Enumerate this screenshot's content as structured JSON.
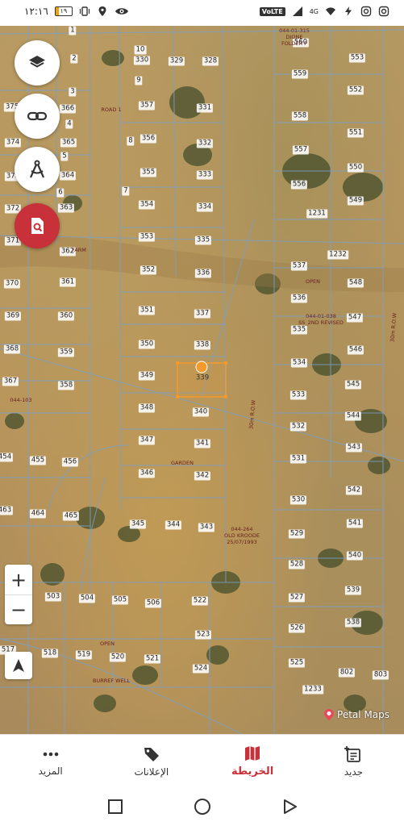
{
  "status_bar": {
    "time": "١٢:١٦",
    "battery_level": "١٩",
    "battery_fraction": 0.19,
    "network": "4G",
    "volte": "VoLTE"
  },
  "map": {
    "attribution": "Petal Maps",
    "selected_parcel": "339",
    "parcels": [
      "1",
      "2",
      "3",
      "4",
      "5",
      "6",
      "7",
      "8",
      "9",
      "10",
      "328",
      "329",
      "330",
      "331",
      "332",
      "333",
      "334",
      "335",
      "336",
      "337",
      "338",
      "339",
      "340",
      "341",
      "342",
      "343",
      "344",
      "345",
      "346",
      "347",
      "348",
      "349",
      "350",
      "351",
      "352",
      "353",
      "354",
      "355",
      "356",
      "357",
      "358",
      "359",
      "360",
      "361",
      "362",
      "363",
      "364",
      "365",
      "366",
      "367",
      "368",
      "369",
      "370",
      "371",
      "372",
      "373",
      "374",
      "375",
      "454",
      "455",
      "456",
      "463",
      "464",
      "465",
      "503",
      "504",
      "505",
      "506",
      "517",
      "518",
      "519",
      "520",
      "521",
      "522",
      "523",
      "524",
      "525",
      "526",
      "527",
      "528",
      "529",
      "530",
      "531",
      "532",
      "533",
      "534",
      "535",
      "536",
      "537",
      "538",
      "539",
      "540",
      "541",
      "542",
      "543",
      "544",
      "545",
      "546",
      "547",
      "548",
      "549",
      "550",
      "551",
      "552",
      "553",
      "556",
      "557",
      "558",
      "559",
      "560",
      "802",
      "803",
      "1231",
      "1232",
      "1233"
    ],
    "annotations": [
      "044-01-315\nDIONE\nFOLDER P",
      "OPEN",
      "044-01-038\nSS_2ND REVISED",
      "044-103",
      "FARM",
      "GARDEN",
      "044-264\nOLD KROODE\n25/07/1993",
      "OPEN",
      "BURREF WELL",
      "30m R.O.W",
      "30m R.O.W",
      "ROAD 1"
    ]
  },
  "controls": {
    "layers_icon": "layers-icon",
    "link_icon": "link-icon",
    "measure_icon": "compass-icon",
    "search_icon": "search-document-icon",
    "zoom_in": "+",
    "zoom_out": "−"
  },
  "bottom_nav": {
    "new": "جديد",
    "map": "الخريطة",
    "ads": "الإعلانات",
    "more": "المزيد"
  },
  "colors": {
    "accent": "#c8303a",
    "selection": "#f29a2e",
    "parcel_line": "#7aa0c8"
  }
}
